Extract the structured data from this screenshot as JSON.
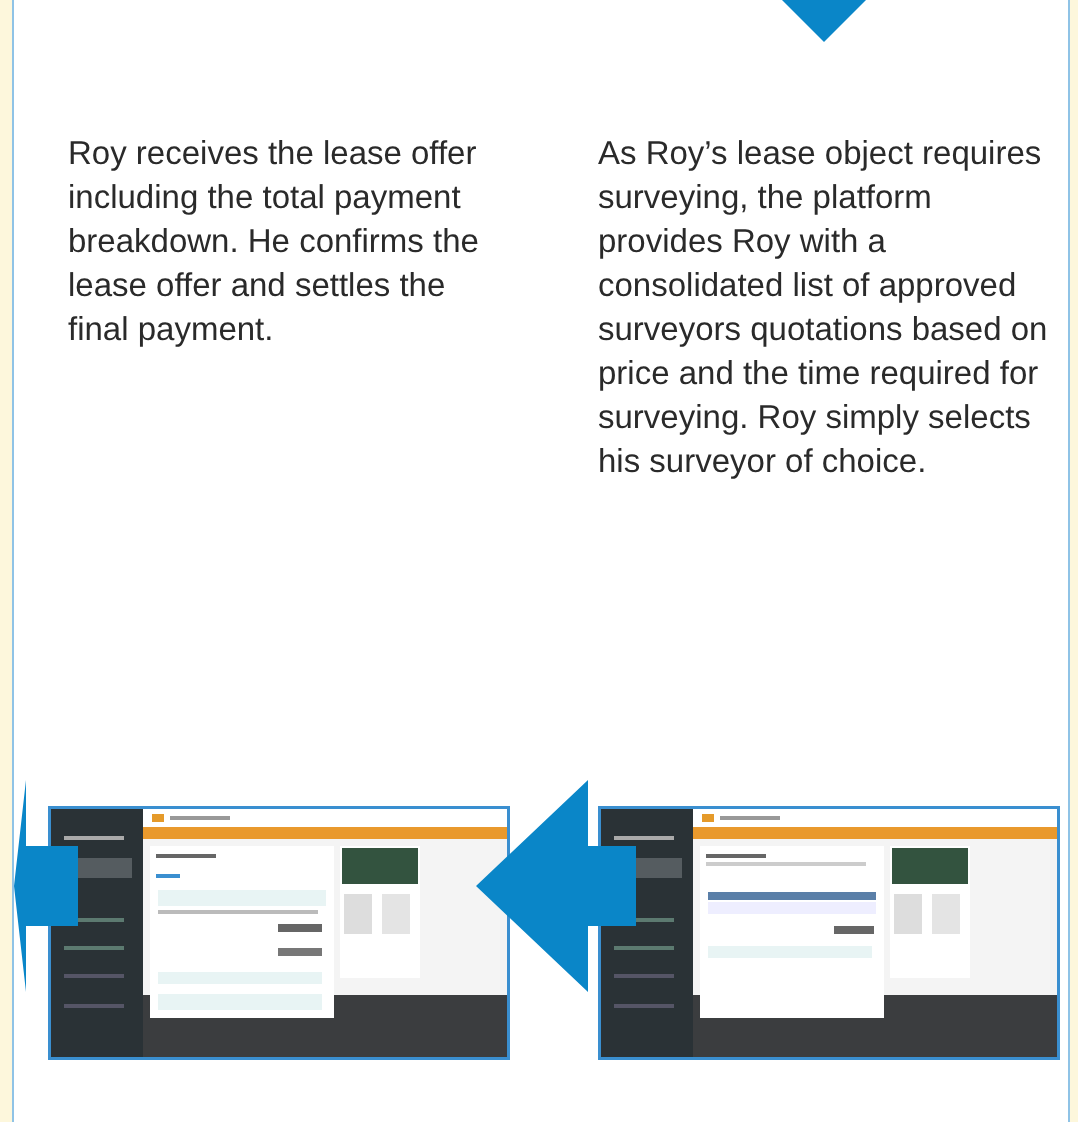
{
  "steps": [
    {
      "text": "Roy receives the lease offer including the total payment breakdown. He confirms the lease offer and settles the final payment."
    },
    {
      "text": "As Roy’s lease object requires surveying, the platform provides Roy with a consolidated list of approved surveyors quotations based on price and the time required for surveying. Roy simply selects his surveyor of choice."
    }
  ]
}
